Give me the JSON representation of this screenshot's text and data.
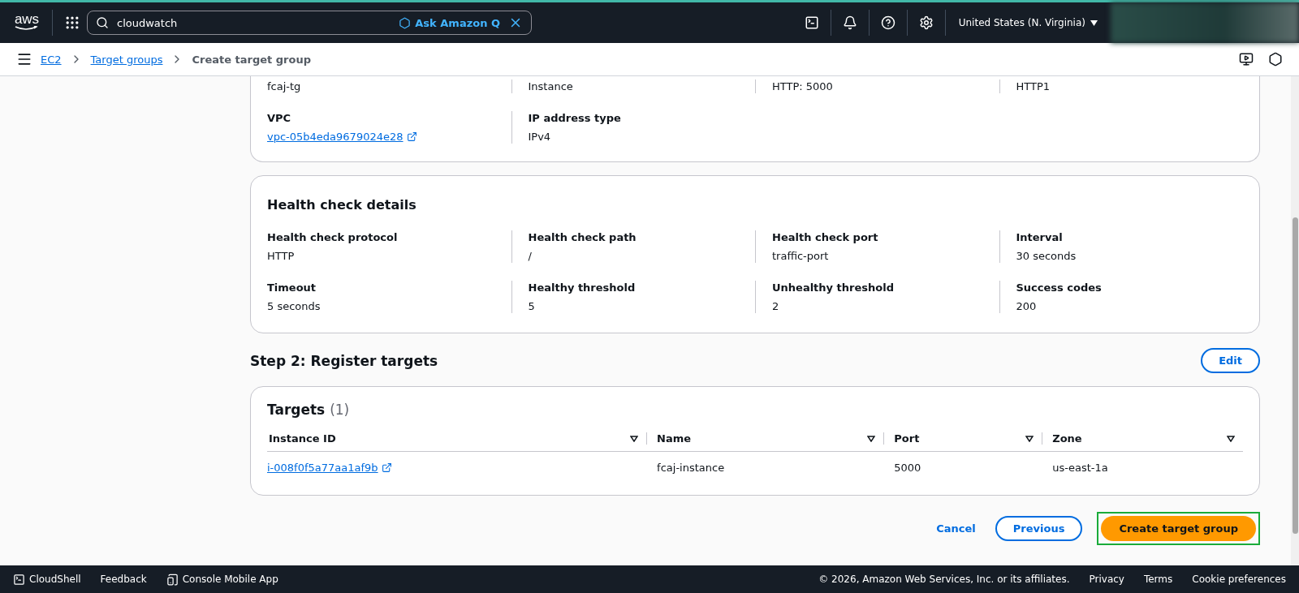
{
  "top_bar": {
    "logo": "aws",
    "search": {
      "value": "cloudwatch"
    },
    "ask_q": "Ask Amazon Q",
    "region": "United States (N. Virginia)"
  },
  "breadcrumbs": [
    {
      "label": "EC2",
      "link": true
    },
    {
      "label": "Target groups",
      "link": true
    },
    {
      "label": "Create target group",
      "link": false
    }
  ],
  "summary_card": {
    "rows": [
      [
        {
          "value": "fcaj-tg"
        },
        {
          "value": "Instance"
        },
        {
          "value": "HTTP: 5000"
        },
        {
          "value": "HTTP1"
        }
      ],
      [
        {
          "label": "VPC",
          "value": "vpc-05b4eda9679024e28",
          "link": true
        },
        {
          "label": "IP address type",
          "value": "IPv4"
        }
      ]
    ]
  },
  "health_card": {
    "title": "Health check details",
    "rows": [
      [
        {
          "label": "Health check protocol",
          "value": "HTTP"
        },
        {
          "label": "Health check path",
          "value": "/"
        },
        {
          "label": "Health check port",
          "value": "traffic-port"
        },
        {
          "label": "Interval",
          "value": "30 seconds"
        }
      ],
      [
        {
          "label": "Timeout",
          "value": "5 seconds"
        },
        {
          "label": "Healthy threshold",
          "value": "5"
        },
        {
          "label": "Unhealthy threshold",
          "value": "2"
        },
        {
          "label": "Success codes",
          "value": "200"
        }
      ]
    ]
  },
  "step2": {
    "title": "Step 2: Register targets",
    "edit": "Edit"
  },
  "targets": {
    "title": "Targets",
    "count": "(1)",
    "columns": [
      "Instance ID",
      "Name",
      "Port",
      "Zone"
    ],
    "rows": [
      [
        "i-008f0f5a77aa1af9b",
        "fcaj-instance",
        "5000",
        "us-east-1a"
      ]
    ]
  },
  "actions": {
    "cancel": "Cancel",
    "previous": "Previous",
    "create": "Create target group"
  },
  "footer": {
    "left": [
      "CloudShell",
      "Feedback",
      "Console Mobile App"
    ],
    "copyright": "© 2026, Amazon Web Services, Inc. or its affiliates.",
    "links": [
      "Privacy",
      "Terms",
      "Cookie preferences"
    ]
  }
}
